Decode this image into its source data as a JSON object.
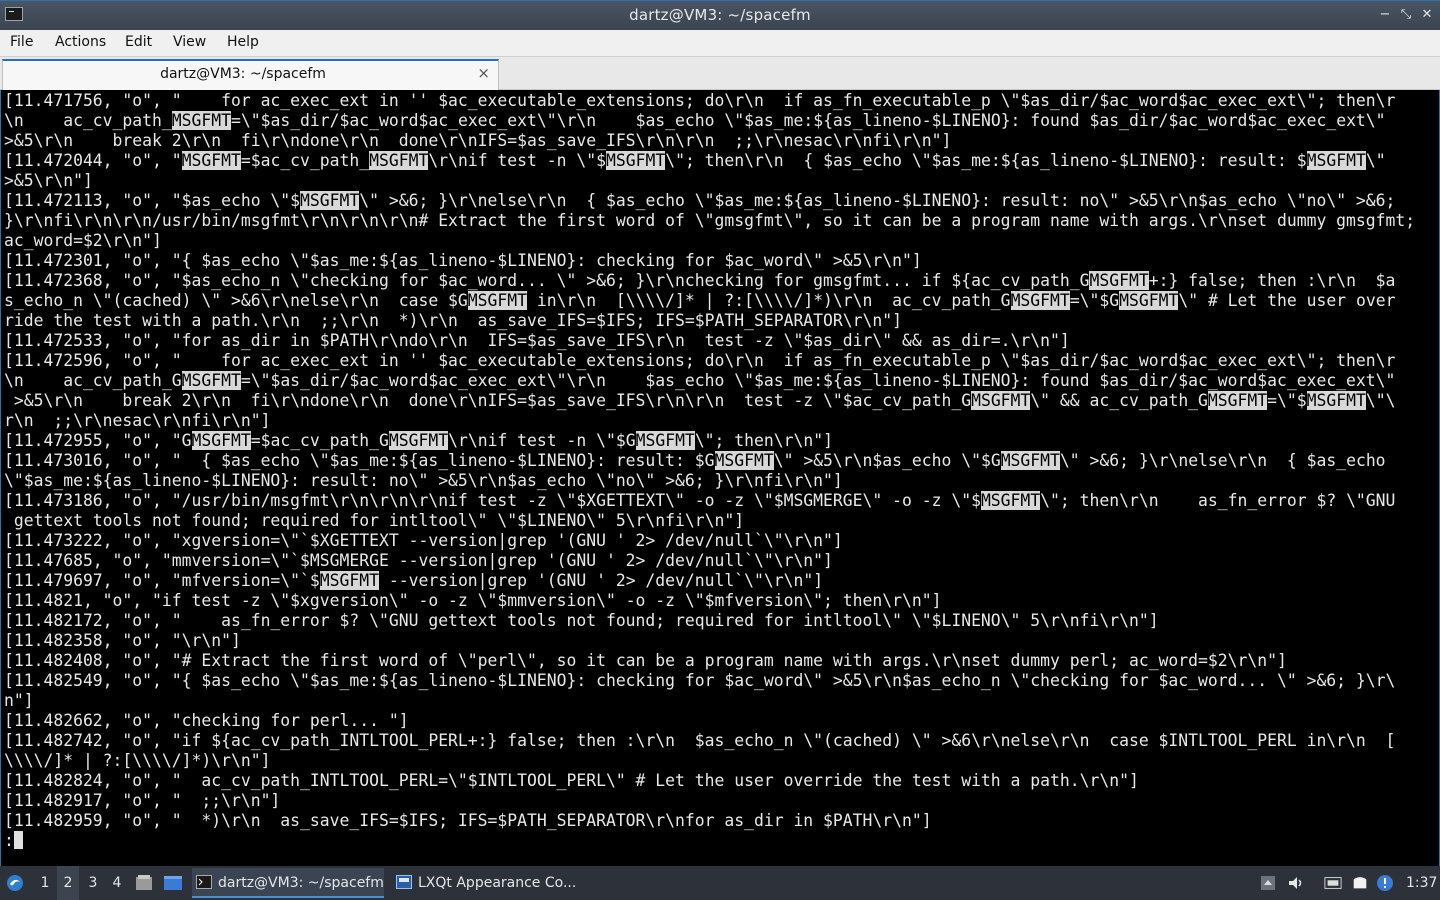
{
  "window": {
    "title": "dartz@VM3: ~/spacefm",
    "controls": {
      "minimize": "−",
      "maximize": "⤡",
      "close": "✕"
    }
  },
  "menu": [
    "File",
    "Actions",
    "Edit",
    "View",
    "Help"
  ],
  "tab": {
    "label": "dartz@VM3: ~/spacefm",
    "close": "×"
  },
  "terminal": {
    "highlight_term": "MSGFMT",
    "prompt": ":",
    "lines": [
      "[11.471756, \"o\", \"    for ac_exec_ext in '' $ac_executable_extensions; do\\r\\n  if as_fn_executable_p \\\"$as_dir/$ac_word$ac_exec_ext\\\"; then\\r",
      "\\n    ac_cv_path_MSGFMT=\\\"$as_dir/$ac_word$ac_exec_ext\\\"\\r\\n    $as_echo \\\"$as_me:${as_lineno-$LINENO}: found $as_dir/$ac_word$ac_exec_ext\\\"",
      ">&5\\r\\n    break 2\\r\\n  fi\\r\\ndone\\r\\n  done\\r\\nIFS=$as_save_IFS\\r\\n\\r\\n  ;;\\r\\nesac\\r\\nfi\\r\\n\"]",
      "[11.472044, \"o\", \"MSGFMT=$ac_cv_path_MSGFMT\\r\\nif test -n \\\"$MSGFMT\\\"; then\\r\\n  { $as_echo \\\"$as_me:${as_lineno-$LINENO}: result: $MSGFMT\\\"",
      ">&5\\r\\n\"]",
      "[11.472113, \"o\", \"$as_echo \\\"$MSGFMT\\\" >&6; }\\r\\nelse\\r\\n  { $as_echo \\\"$as_me:${as_lineno-$LINENO}: result: no\\\" >&5\\r\\n$as_echo \\\"no\\\" >&6;",
      "}\\r\\nfi\\r\\n\\r\\n/usr/bin/msgfmt\\r\\n\\r\\n\\r\\n# Extract the first word of \\\"gmsgfmt\\\", so it can be a program name with args.\\r\\nset dummy gmsgfmt;",
      "ac_word=$2\\r\\n\"]",
      "[11.472301, \"o\", \"{ $as_echo \\\"$as_me:${as_lineno-$LINENO}: checking for $ac_word\\\" >&5\\r\\n\"]",
      "[11.472368, \"o\", \"$as_echo_n \\\"checking for $ac_word... \\\" >&6; }\\r\\nchecking for gmsgfmt... if ${ac_cv_path_GMSGFMT+:} false; then :\\r\\n  $a",
      "s_echo_n \\\"(cached) \\\" >&6\\r\\nelse\\r\\n  case $GMSGFMT in\\r\\n  [\\\\\\\\/]* | ?:[\\\\\\\\/]*)\\r\\n  ac_cv_path_GMSGFMT=\\\"$GMSGFMT\\\" # Let the user over",
      "ride the test with a path.\\r\\n  ;;\\r\\n  *)\\r\\n  as_save_IFS=$IFS; IFS=$PATH_SEPARATOR\\r\\n\"]",
      "[11.472533, \"o\", \"for as_dir in $PATH\\r\\ndo\\r\\n  IFS=$as_save_IFS\\r\\n  test -z \\\"$as_dir\\\" && as_dir=.\\r\\n\"]",
      "[11.472596, \"o\", \"    for ac_exec_ext in '' $ac_executable_extensions; do\\r\\n  if as_fn_executable_p \\\"$as_dir/$ac_word$ac_exec_ext\\\"; then\\r",
      "\\n    ac_cv_path_GMSGFMT=\\\"$as_dir/$ac_word$ac_exec_ext\\\"\\r\\n    $as_echo \\\"$as_me:${as_lineno-$LINENO}: found $as_dir/$ac_word$ac_exec_ext\\\"",
      " >&5\\r\\n    break 2\\r\\n  fi\\r\\ndone\\r\\n  done\\r\\nIFS=$as_save_IFS\\r\\n\\r\\n  test -z \\\"$ac_cv_path_GMSGFMT\\\" && ac_cv_path_GMSGFMT=\\\"$MSGFMT\\\"\\",
      "r\\n  ;;\\r\\nesac\\r\\nfi\\r\\n\"]",
      "[11.472955, \"o\", \"GMSGFMT=$ac_cv_path_GMSGFMT\\r\\nif test -n \\\"$GMSGFMT\\\"; then\\r\\n\"]",
      "[11.473016, \"o\", \"  { $as_echo \\\"$as_me:${as_lineno-$LINENO}: result: $GMSGFMT\\\" >&5\\r\\n$as_echo \\\"$GMSGFMT\\\" >&6; }\\r\\nelse\\r\\n  { $as_echo",
      "\\\"$as_me:${as_lineno-$LINENO}: result: no\\\" >&5\\r\\n$as_echo \\\"no\\\" >&6; }\\r\\nfi\\r\\n\"]",
      "[11.473186, \"o\", \"/usr/bin/msgfmt\\r\\n\\r\\n\\r\\nif test -z \\\"$XGETTEXT\\\" -o -z \\\"$MSGMERGE\\\" -o -z \\\"$MSGFMT\\\"; then\\r\\n    as_fn_error $? \\\"GNU",
      " gettext tools not found; required for intltool\\\" \\\"$LINENO\\\" 5\\r\\nfi\\r\\n\"]",
      "[11.473222, \"o\", \"xgversion=\\\"`$XGETTEXT --version|grep '(GNU ' 2> /dev/null`\\\"\\r\\n\"]",
      "[11.47685, \"o\", \"mmversion=\\\"`$MSGMERGE --version|grep '(GNU ' 2> /dev/null`\\\"\\r\\n\"]",
      "[11.479697, \"o\", \"mfversion=\\\"`$MSGFMT --version|grep '(GNU ' 2> /dev/null`\\\"\\r\\n\"]",
      "[11.4821, \"o\", \"if test -z \\\"$xgversion\\\" -o -z \\\"$mmversion\\\" -o -z \\\"$mfversion\\\"; then\\r\\n\"]",
      "[11.482172, \"o\", \"    as_fn_error $? \\\"GNU gettext tools not found; required for intltool\\\" \\\"$LINENO\\\" 5\\r\\nfi\\r\\n\"]",
      "[11.482358, \"o\", \"\\r\\n\"]",
      "[11.482408, \"o\", \"# Extract the first word of \\\"perl\\\", so it can be a program name with args.\\r\\nset dummy perl; ac_word=$2\\r\\n\"]",
      "[11.482549, \"o\", \"{ $as_echo \\\"$as_me:${as_lineno-$LINENO}: checking for $ac_word\\\" >&5\\r\\n$as_echo_n \\\"checking for $ac_word... \\\" >&6; }\\r\\",
      "n\"]",
      "[11.482662, \"o\", \"checking for perl... \"]",
      "[11.482742, \"o\", \"if ${ac_cv_path_INTLTOOL_PERL+:} false; then :\\r\\n  $as_echo_n \\\"(cached) \\\" >&6\\r\\nelse\\r\\n  case $INTLTOOL_PERL in\\r\\n  [",
      "\\\\\\\\/]* | ?:[\\\\\\\\/]*)\\r\\n\"]",
      "[11.482824, \"o\", \"  ac_cv_path_INTLTOOL_PERL=\\\"$INTLTOOL_PERL\\\" # Let the user override the test with a path.\\r\\n\"]",
      "[11.482917, \"o\", \"  ;;\\r\\n\"]",
      "[11.482959, \"o\", \"  *)\\r\\n  as_save_IFS=$IFS; IFS=$PATH_SEPARATOR\\r\\nfor as_dir in $PATH\\r\\n\"]"
    ]
  },
  "taskbar": {
    "desktops": [
      "1",
      "2",
      "3",
      "4"
    ],
    "active_desktop": "2",
    "tasks": [
      {
        "label": "dartz@VM3: ~/spacefm",
        "icon": "terminal-icon"
      },
      {
        "label": "LXQt Appearance Co...",
        "icon": "appearance-icon"
      }
    ],
    "clock": "1:37"
  },
  "colors": {
    "accent": "#2f6fb5",
    "terminal_bg": "#000000",
    "terminal_fg": "#e8e8e8",
    "taskbar_bg": "#2c313a"
  }
}
